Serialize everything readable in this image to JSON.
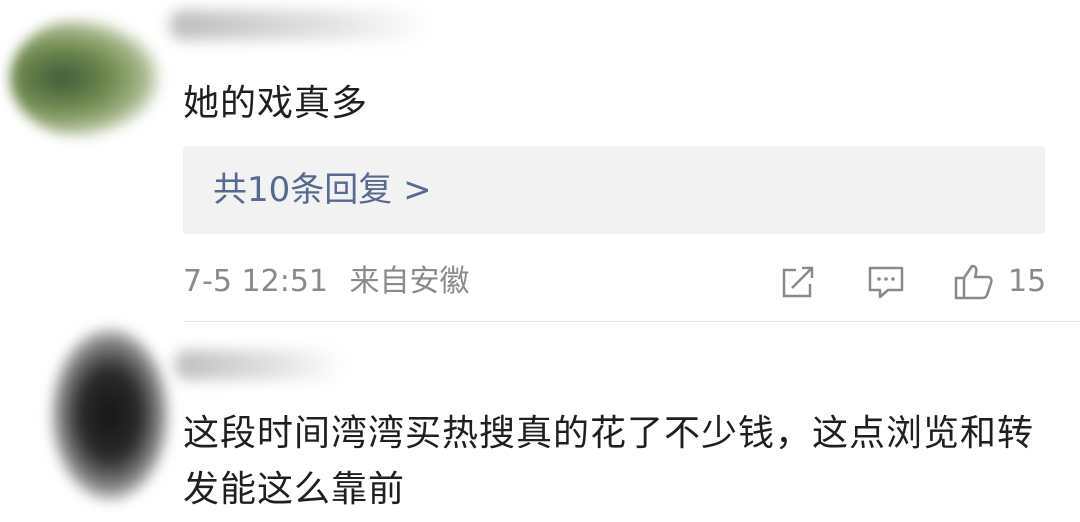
{
  "comments": [
    {
      "text": "她的戏真多",
      "replies_link": "共10条回复 >",
      "time": "7-5 12:51",
      "source": "来自安徽",
      "likes": "15",
      "icons": {
        "share": "share-icon",
        "comment": "comment-icon",
        "like": "thumbs-up-icon"
      }
    },
    {
      "text": "这段时间湾湾买热搜真的花了不少钱，这点浏览和转发能这么靠前"
    }
  ]
}
